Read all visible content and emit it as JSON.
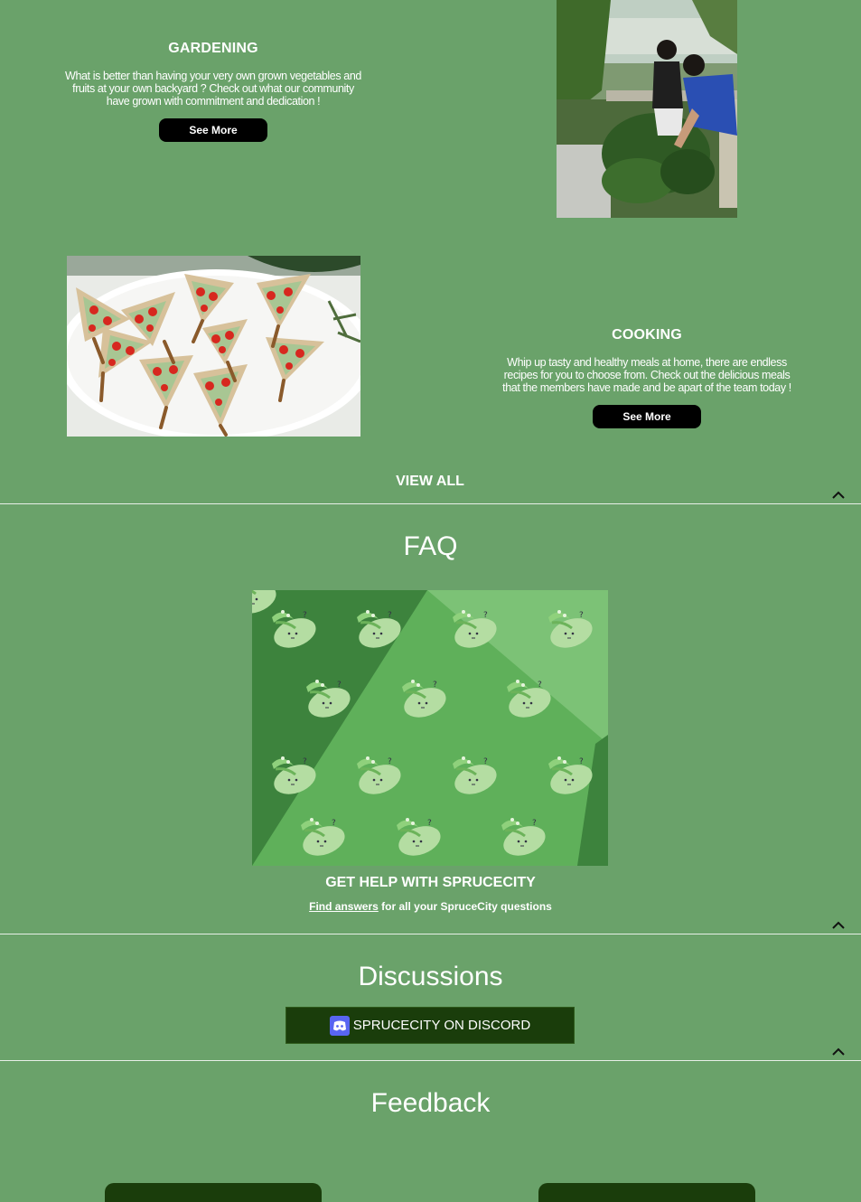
{
  "gardening": {
    "title": "GARDENING",
    "description_lines": [
      "What is better than having your very own grown vegetables and",
      "fruits at your own backyard ? Check out what our community",
      "have grown with commitment and dedication !"
    ],
    "button_label": "See More"
  },
  "cooking": {
    "title": "COOKING",
    "description_lines": [
      "Whip up tasty and healthy meals at home, there are endless",
      "recipes for you to choose from. Check out the delicious meals",
      "that the members have made and be apart of the team today !"
    ],
    "button_label": "See More"
  },
  "view_all_label": "VIEW ALL",
  "faq": {
    "title": "FAQ",
    "help_title": "GET HELP WITH SPRUCECITY",
    "help_link": "Find answers",
    "help_rest": " for all your SpruceCity questions"
  },
  "discussions": {
    "title": "Discussions",
    "button_label": "SPRUCECITY ON DISCORD"
  },
  "feedback": {
    "title": "Feedback"
  },
  "colors": {
    "background": "#6aa26a",
    "dark_green": "#1a3d0b",
    "button_black": "#000000"
  }
}
